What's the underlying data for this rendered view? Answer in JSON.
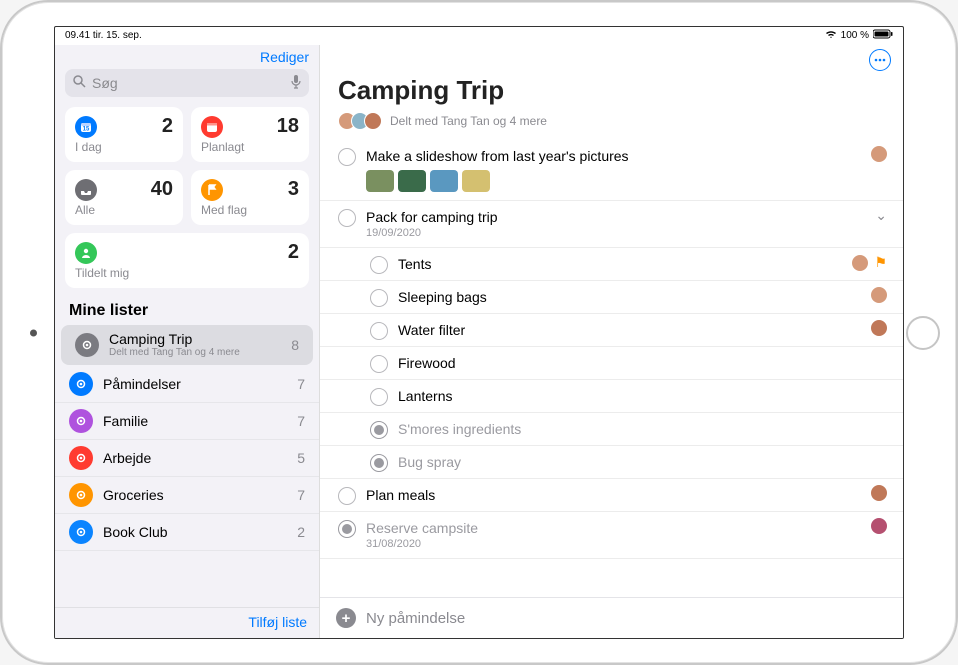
{
  "statusbar": {
    "time": "09.41",
    "date": "tir. 15. sep.",
    "battery": "100 %"
  },
  "sidebar": {
    "edit_label": "Rediger",
    "search_placeholder": "Søg",
    "smart": {
      "today": {
        "label": "I dag",
        "count": "2",
        "color": "#007aff"
      },
      "scheduled": {
        "label": "Planlagt",
        "count": "18",
        "color": "#ff3b30"
      },
      "all": {
        "label": "Alle",
        "count": "40",
        "color": "#6e6e73"
      },
      "flagged": {
        "label": "Med flag",
        "count": "3",
        "color": "#ff9500"
      },
      "assigned": {
        "label": "Tildelt mig",
        "count": "2",
        "color": "#34c759"
      }
    },
    "section_header": "Mine lister",
    "lists": [
      {
        "name": "Camping Trip",
        "subtitle": "Delt med Tang Tan og 4 mere",
        "count": "8",
        "color": "#7b7b81",
        "selected": true
      },
      {
        "name": "Påmindelser",
        "count": "7",
        "color": "#007aff"
      },
      {
        "name": "Familie",
        "count": "7",
        "color": "#af52de"
      },
      {
        "name": "Arbejde",
        "count": "5",
        "color": "#ff3b30"
      },
      {
        "name": "Groceries",
        "count": "7",
        "color": "#ff9500"
      },
      {
        "name": "Book Club",
        "count": "2",
        "color": "#0a84ff"
      }
    ],
    "add_list_label": "Tilføj liste"
  },
  "main": {
    "title": "Camping Trip",
    "shared_text": "Delt med Tang Tan og 4 mere",
    "items": [
      {
        "title": "Make a slideshow from last year's pictures",
        "avatarColor": "#d59a7a",
        "thumbs": [
          "#7a9060",
          "#3a6b4a",
          "#5a98c0",
          "#d4c070"
        ]
      },
      {
        "title": "Pack for camping trip",
        "date": "19/09/2020",
        "expandable": true
      },
      {
        "title": "Tents",
        "sub": true,
        "avatarColor": "#d59a7a",
        "flagged": true
      },
      {
        "title": "Sleeping bags",
        "sub": true,
        "avatarColor": "#d59a7a"
      },
      {
        "title": "Water filter",
        "sub": true,
        "avatarColor": "#c07858"
      },
      {
        "title": "Firewood",
        "sub": true
      },
      {
        "title": "Lanterns",
        "sub": true
      },
      {
        "title": "S'mores ingredients",
        "sub": true,
        "done": true
      },
      {
        "title": "Bug spray",
        "sub": true,
        "done": true
      },
      {
        "title": "Plan meals",
        "avatarColor": "#c07858"
      },
      {
        "title": "Reserve campsite",
        "date": "31/08/2020",
        "done": true,
        "avatarColor": "#b55070"
      }
    ],
    "new_reminder_label": "Ny påmindelse"
  }
}
